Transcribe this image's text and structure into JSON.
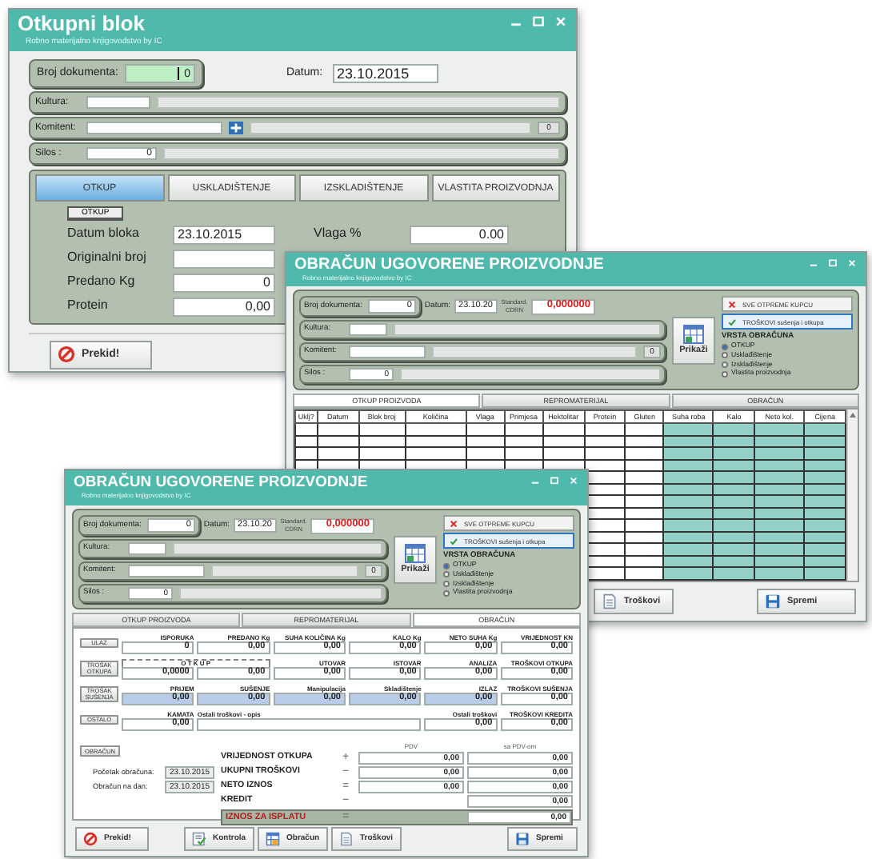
{
  "otkupni_blok": {
    "title": "Otkupni blok",
    "subtitle": "Robno materijalno knjigovodstvo by IC",
    "broj_dokumenta": {
      "label": "Broj dokumenta:",
      "value": "0"
    },
    "datum": {
      "label": "Datum:",
      "value": "23.10.2015"
    },
    "kultura": {
      "label": "Kultura:"
    },
    "komitent": {
      "label": "Komitent:",
      "count": "0"
    },
    "silos": {
      "label": "Silos :",
      "value": "0"
    },
    "tabs": [
      {
        "label": "OTKUP",
        "selected": true
      },
      {
        "label": "USKLADIŠTENJE",
        "selected": false
      },
      {
        "label": "IZSKLADIŠTENJE",
        "selected": false
      },
      {
        "label": "VLASTITA PROIZVODNJA",
        "selected": false
      }
    ],
    "group_label": "OTKUP",
    "fields": [
      {
        "label": "Datum bloka",
        "value": "23.10.2015"
      },
      {
        "label": "Originalni broj"
      },
      {
        "label": "Predano Kg",
        "value": "0"
      },
      {
        "label": "Protein",
        "value": "0,00"
      }
    ],
    "vlaga": {
      "label": "Vlaga %",
      "value": "0.00"
    },
    "buttons": [
      {
        "label": "Prekid!",
        "kind": "stop"
      }
    ]
  },
  "obracun_back": {
    "title": "OBRAČUN UGOVORENE PROIZVODNJE",
    "subtitle": "Robno materijalno knjigovodstvo by IC",
    "broj": {
      "label": "Broj dokumenta:",
      "value": "0"
    },
    "datum": {
      "label": "Datum:",
      "value": "23.10.20"
    },
    "standard": {
      "label": "Standard. CDRN",
      "value": "0,000000"
    },
    "kultura": {
      "label": "Kultura:"
    },
    "komitent": {
      "label": "Komitent:",
      "count": "0"
    },
    "silos": {
      "label": "Silos :",
      "value": "0"
    },
    "toggles": [
      {
        "label": "SVE OTPREME KUPCU",
        "checked": false
      },
      {
        "label": "TROŠKOVI sušenja i otkupa",
        "checked": true
      }
    ],
    "prikazi": "Prikaži",
    "vrsta": {
      "title": "VRSTA OBRAČUNA",
      "options": [
        {
          "label": "OTKUP",
          "selected": true
        },
        {
          "label": "Usklađištenje",
          "selected": false
        },
        {
          "label": "Izsklađištenje",
          "selected": false
        },
        {
          "label": "Vlastita proizvodnja",
          "selected": false
        }
      ]
    },
    "tabs": [
      {
        "label": "OTKUP PROIZVODA",
        "selected": true
      },
      {
        "label": "REPROMATERIJAL",
        "selected": false
      },
      {
        "label": "OBRAČUN",
        "selected": false
      }
    ],
    "columns": [
      {
        "label": "Uklj?",
        "shaded": false
      },
      {
        "label": "Datum",
        "shaded": false
      },
      {
        "label": "Blok broj",
        "shaded": false
      },
      {
        "label": "Količina",
        "shaded": false
      },
      {
        "label": "Vlaga",
        "shaded": false
      },
      {
        "label": "Primjesa",
        "shaded": false
      },
      {
        "label": "Hektolitar",
        "shaded": false
      },
      {
        "label": "Protein",
        "shaded": false
      },
      {
        "label": "Gluten",
        "shaded": false
      },
      {
        "label": "Suha roba",
        "shaded": true
      },
      {
        "label": "Kalo",
        "shaded": true
      },
      {
        "label": "Neto kol.",
        "shaded": true
      },
      {
        "label": "Cijena",
        "shaded": true
      }
    ],
    "buttons": [
      {
        "label": "Troškovi",
        "kind": "document"
      },
      {
        "label": "Spremi",
        "kind": "save"
      }
    ]
  },
  "obracun_front": {
    "title": "OBRAČUN UGOVORENE PROIZVODNJE",
    "subtitle": "Robno materijalno knjigovodstvo by IC",
    "broj": {
      "label": "Broj dokumenta:",
      "value": "0"
    },
    "datum": {
      "label": "Datum:",
      "value": "23.10.20"
    },
    "standard": {
      "label": "Standard. CDRN",
      "value": "0,000000"
    },
    "kultura": {
      "label": "Kultura:"
    },
    "komitent": {
      "label": "Komitent:",
      "count": "0"
    },
    "silos": {
      "label": "Silos :",
      "value": "0"
    },
    "toggles": [
      {
        "label": "SVE OTPREME KUPCU",
        "checked": false
      },
      {
        "label": "TROŠKOVI sušenja i otkupa",
        "checked": true
      }
    ],
    "prikazi": "Prikaži",
    "vrsta": {
      "title": "VRSTA OBRAČUNA",
      "options": [
        {
          "label": "OTKUP",
          "selected": true
        },
        {
          "label": "Usklađištenje",
          "selected": false
        },
        {
          "label": "Izsklađištenje",
          "selected": false
        },
        {
          "label": "Vlastita proizvodnja",
          "selected": false
        }
      ]
    },
    "tabs": [
      {
        "label": "OTKUP PROIZVODA",
        "selected": false
      },
      {
        "label": "REPROMATERIJAL",
        "selected": false
      },
      {
        "label": "OBRAČUN",
        "selected": true
      }
    ],
    "calc": {
      "rows": [
        {
          "button": "ULAZ",
          "cells": [
            {
              "header": "ISPORUKA",
              "value": "0"
            },
            {
              "header": "PREDANO Kg",
              "value": "0,00"
            },
            {
              "header": "SUHA KOLIČINA Kg",
              "value": "0,00"
            },
            {
              "header": "KALO Kg",
              "value": "0,00"
            },
            {
              "header": "NETO SUHA Kg",
              "value": "0,00"
            },
            {
              "header": "VRIJEDNOST KN",
              "value": "0,00"
            }
          ]
        },
        {
          "button": "TROŠAK OTKUPA",
          "cells": [
            {
              "header": "O T K U P",
              "kind": "group",
              "value": "0,0000"
            },
            {
              "value": "0,00"
            },
            {
              "header": "UTOVAR",
              "value": "0,00"
            },
            {
              "header": "ISTOVAR",
              "value": "0,00"
            },
            {
              "header": "ANALIZA",
              "value": "0,00"
            },
            {
              "header": "TROŠKOVI OTKUPA",
              "value": "0,00"
            }
          ]
        },
        {
          "button": "TROŠAK SUŠENJA",
          "cells": [
            {
              "header": "PRIJEM",
              "value": "0,00",
              "highlighted": true
            },
            {
              "header": "SUŠENJE",
              "value": "0,00",
              "highlighted": true
            },
            {
              "header": "Manipulacija",
              "value": "0,00",
              "highlighted": true
            },
            {
              "header": "Skladištenje",
              "value": "0,00",
              "highlighted": true
            },
            {
              "header": "IZLAZ",
              "value": "0,00",
              "highlighted": true
            },
            {
              "header": "TROŠKOVI SUŠENJA",
              "value": "0,00",
              "highlighted": false
            }
          ]
        },
        {
          "button": "OSTALO",
          "cells": [
            {
              "header": "KAMATA",
              "value": "0,00"
            },
            {
              "header": "Ostali troškovi - opis",
              "kind": "wide"
            },
            {
              "kind": "filler"
            },
            {
              "kind": "filler"
            },
            {
              "header": "Ostali troškovi",
              "value": "0,00"
            },
            {
              "header": "TROŠKOVI KREDITA",
              "value": "0,00"
            }
          ]
        }
      ]
    },
    "summary": {
      "button": "OBRAČUN",
      "col_headers": [
        "PDV",
        "sa PDV-om"
      ],
      "lines": [
        {
          "label": "VRIJEDNOST OTKUPA",
          "sign": "+",
          "pdv": "0,00",
          "sa_pdv": "0,00"
        },
        {
          "label": "UKUPNI TROŠKOVI",
          "sign": "−",
          "pdv": "0,00",
          "sa_pdv": "0,00"
        },
        {
          "label": "NETO IZNOS",
          "sign": "=",
          "pdv": "0,00",
          "sa_pdv": "0,00"
        },
        {
          "label": "KREDIT",
          "sign": "−",
          "sa_pdv": "0,00"
        }
      ],
      "total": {
        "label": "IZNOS ZA ISPLATU",
        "sign": "=",
        "value": "0,00"
      },
      "dates": [
        {
          "label": "Početak obračuna:",
          "value": "23.10.2015"
        },
        {
          "label": "Obračun na dan:",
          "value": "23.10.2015"
        }
      ]
    },
    "buttons": [
      {
        "label": "Prekid!",
        "kind": "stop"
      },
      {
        "label": "Kontrola",
        "kind": "checklist"
      },
      {
        "label": "Obračun",
        "kind": "spreadsheet"
      },
      {
        "label": "Troškovi",
        "kind": "document"
      },
      {
        "label": "Spremi",
        "kind": "save"
      }
    ]
  }
}
